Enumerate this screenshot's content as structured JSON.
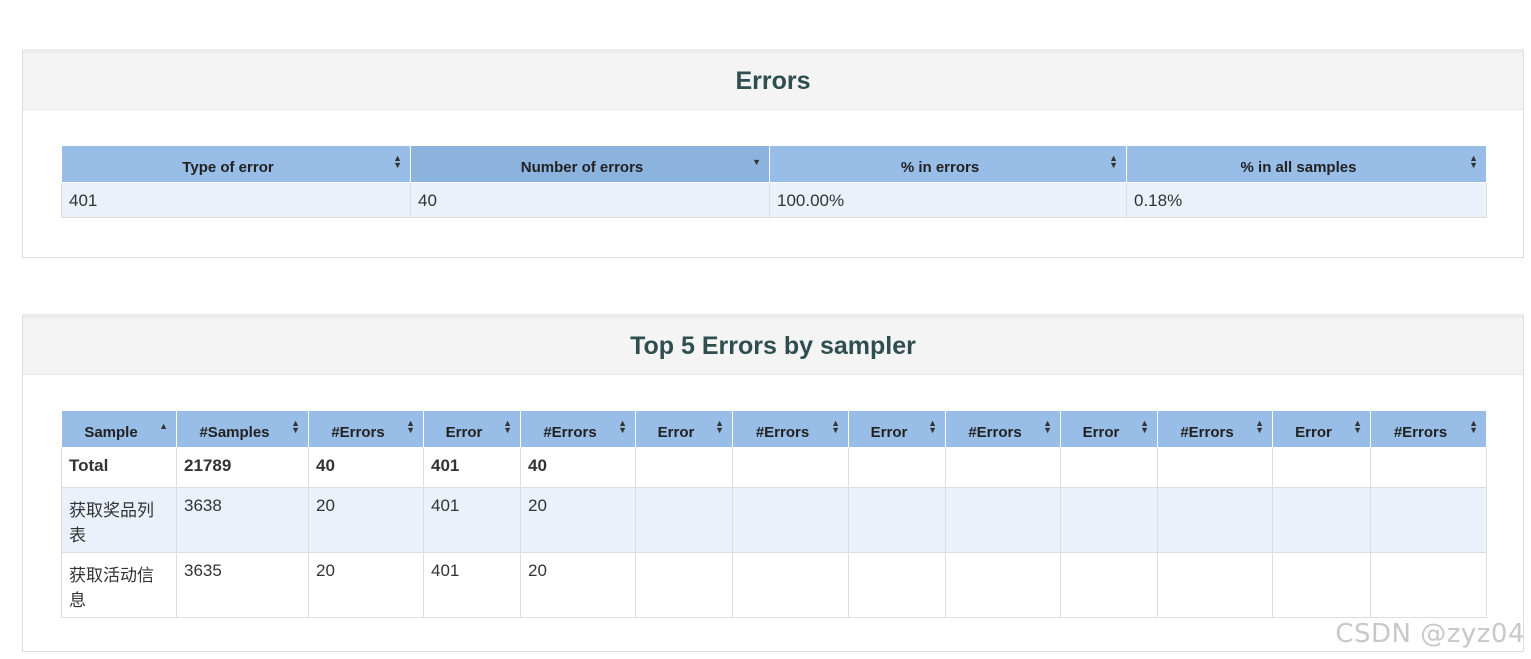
{
  "errors_panel": {
    "title": "Errors",
    "columns": [
      "Type of error",
      "Number of errors",
      "% in errors",
      "% in all samples"
    ],
    "sorted_column": "Number of errors",
    "rows": [
      [
        "401",
        "40",
        "100.00%",
        "0.18%"
      ]
    ]
  },
  "top5_panel": {
    "title": "Top 5 Errors by sampler",
    "columns": [
      "Sample",
      "#Samples",
      "#Errors",
      "Error",
      "#Errors",
      "Error",
      "#Errors",
      "Error",
      "#Errors",
      "Error",
      "#Errors",
      "Error",
      "#Errors"
    ],
    "sorted_column": "Sample",
    "total_row": [
      "Total",
      "21789",
      "40",
      "401",
      "40",
      "",
      "",
      "",
      "",
      "",
      "",
      "",
      ""
    ],
    "rows": [
      [
        "获取奖品列表",
        "3638",
        "20",
        "401",
        "20",
        "",
        "",
        "",
        "",
        "",
        "",
        "",
        ""
      ],
      [
        "获取活动信息",
        "3635",
        "20",
        "401",
        "20",
        "",
        "",
        "",
        "",
        "",
        "",
        "",
        ""
      ]
    ]
  },
  "watermark": "CSDN @zyz04",
  "colors": {
    "header_bg": "#98bde6",
    "row_alt_bg": "#eaf1fa",
    "title_color": "#2e4e50"
  },
  "icons": {
    "sort_both": "sort-both-icon",
    "sort_desc": "sort-desc-icon",
    "sort_asc": "sort-asc-icon"
  }
}
